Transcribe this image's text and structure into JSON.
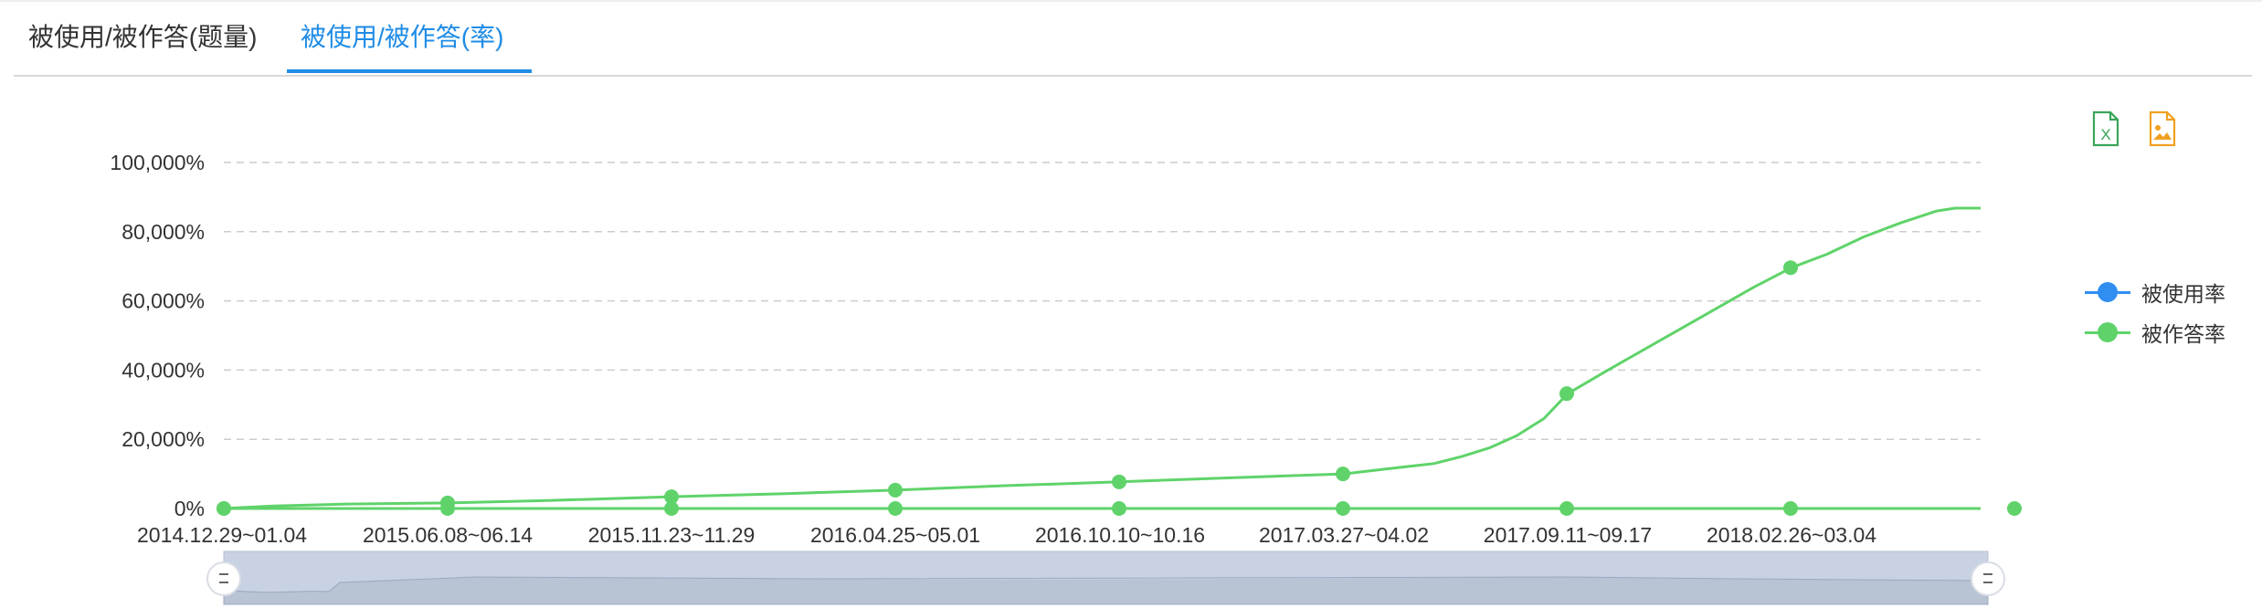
{
  "tabs": [
    {
      "label": "被使用/被作答(题量)",
      "active": false
    },
    {
      "label": "被使用/被作答(率)",
      "active": true
    }
  ],
  "toolbar": {
    "excel_icon": "excel-export-icon",
    "image_icon": "image-save-icon",
    "excel_color": "#3aa55a",
    "image_color": "#f0a020"
  },
  "chart_data": {
    "type": "line",
    "title": "",
    "xlabel": "",
    "ylabel": "",
    "y_tick_labels": [
      "0%",
      "20,000%",
      "40,000%",
      "60,000%",
      "80,000%",
      "100,000%"
    ],
    "ylim": [
      0,
      100000
    ],
    "grid": "horizontal dashed",
    "legend_position": "right",
    "x_tick_labels": [
      "2014.12.29~01.04",
      "2015.06.08~06.14",
      "2015.11.23~11.29",
      "2016.04.25~05.01",
      "2016.10.10~10.16",
      "2017.03.27~04.02",
      "2017.09.11~09.17",
      "2018.02.26~03.04"
    ],
    "series": [
      {
        "name": "被使用率",
        "color": "#2f8ef0",
        "values": [
          0,
          0,
          0,
          0,
          0,
          0,
          0,
          0,
          0
        ]
      },
      {
        "name": "被作答率",
        "color": "#5fd36a",
        "values": [
          0,
          1600,
          3400,
          5300,
          7700,
          10000,
          33200,
          69600,
          86800
        ]
      }
    ],
    "data_zoom": {
      "start": 0,
      "end": 100
    }
  }
}
